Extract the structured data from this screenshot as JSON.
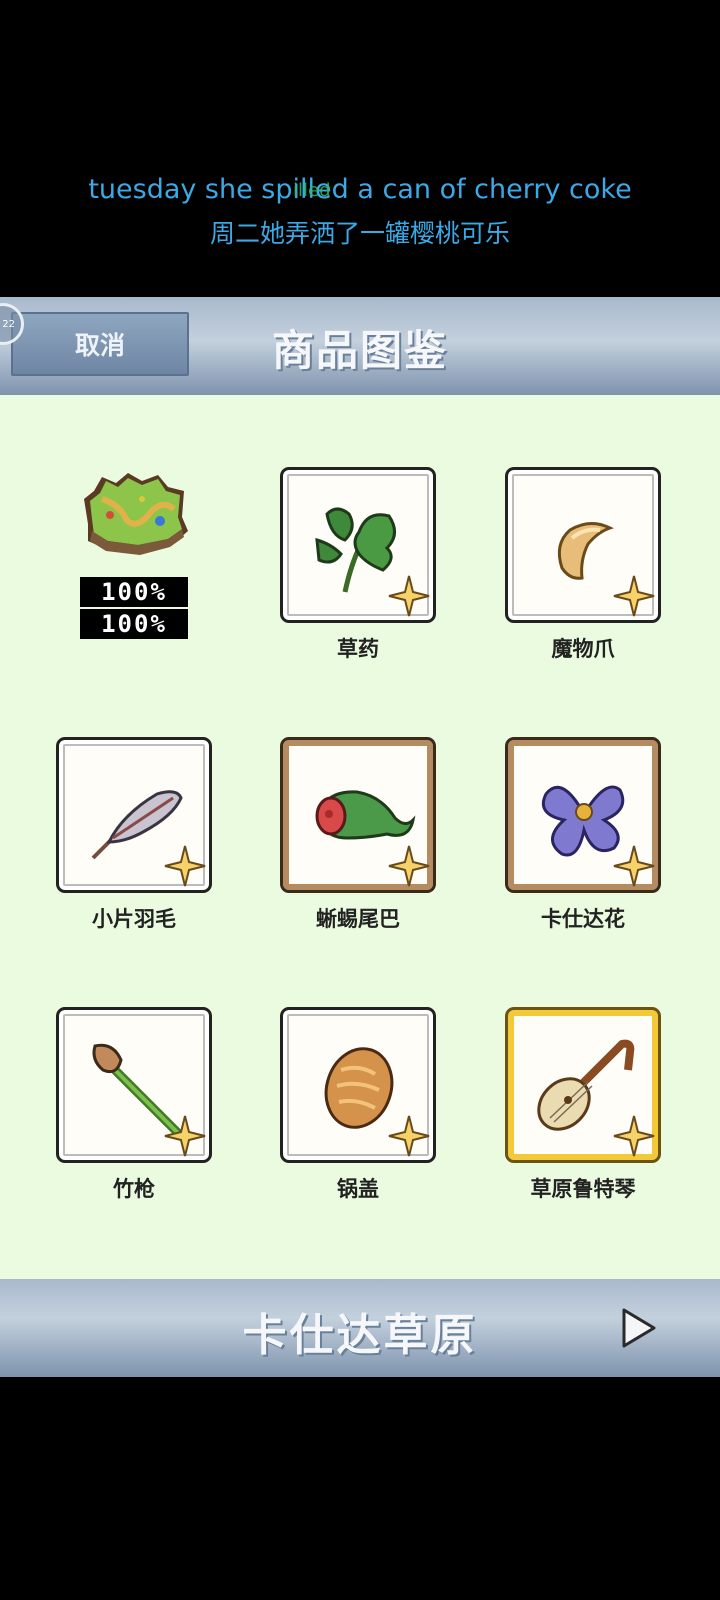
{
  "lyrics": {
    "line_en": "tuesday she spilled a can of cherry coke",
    "line_zh": "周二她弄洒了一罐樱桃可乐",
    "overlay_fragment": "illed"
  },
  "header": {
    "badge": "22",
    "cancel_label": "取消",
    "title": "商品图鉴"
  },
  "region": {
    "icon": "grassland-map-icon",
    "progress_1": "100%",
    "progress_2": "100%"
  },
  "items": [
    {
      "name": "草药",
      "icon": "herb-icon",
      "frame": "plain"
    },
    {
      "name": "魔物爪",
      "icon": "monster-claw-icon",
      "frame": "plain"
    },
    {
      "name": "小片羽毛",
      "icon": "feather-icon",
      "frame": "plain"
    },
    {
      "name": "蜥蜴尾巴",
      "icon": "lizard-tail-icon",
      "frame": "brown"
    },
    {
      "name": "卡仕达花",
      "icon": "flower-icon",
      "frame": "brown"
    },
    {
      "name": "竹枪",
      "icon": "bamboo-spear-icon",
      "frame": "plain"
    },
    {
      "name": "锅盖",
      "icon": "pot-lid-icon",
      "frame": "plain"
    },
    {
      "name": "草原鲁特琴",
      "icon": "lute-icon",
      "frame": "gold"
    }
  ],
  "footer": {
    "area_name": "卡仕达草原",
    "next_icon": "play-arrow-icon"
  },
  "colors": {
    "lyric": "#3aa9e6",
    "panel_bg": "#ebfbe0",
    "header_blue": "#8fa6c0",
    "gold_frame": "#f3c93a",
    "brown_frame": "#b58b61"
  }
}
